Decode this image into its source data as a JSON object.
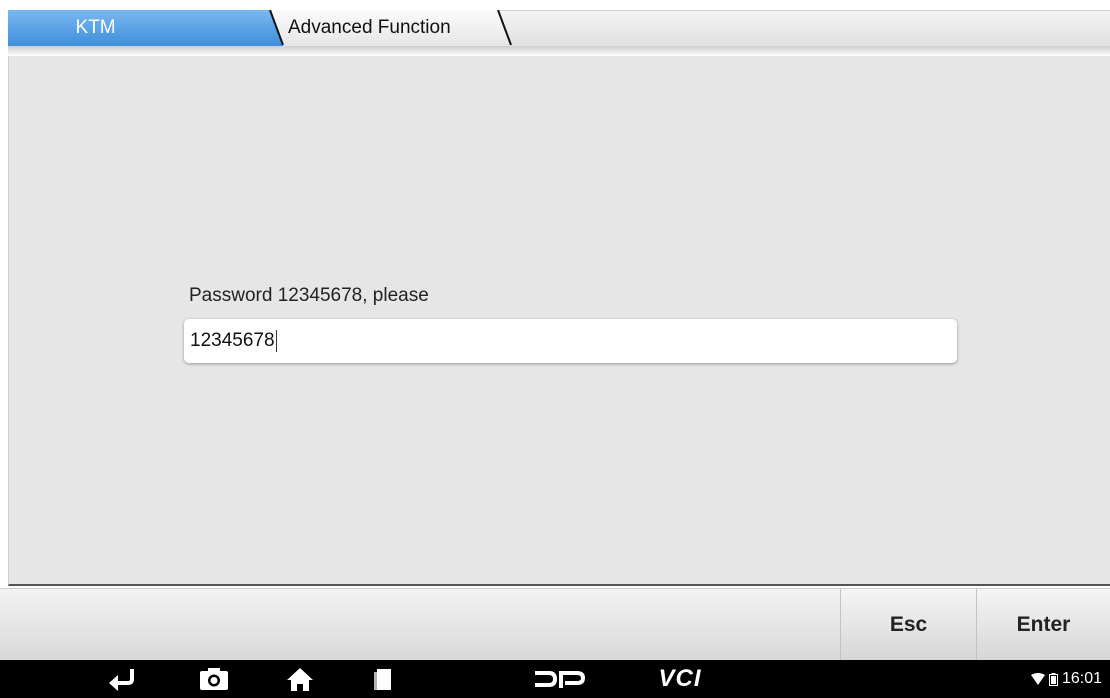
{
  "tabs": {
    "active_label": "KTM",
    "second_label": "Advanced Function"
  },
  "dialog": {
    "prompt": "Password 12345678, please",
    "input_value": "12345678"
  },
  "buttons": {
    "esc_label": "Esc",
    "enter_label": "Enter"
  },
  "navbar": {
    "icons": [
      "back-icon",
      "screenshot-icon",
      "home-icon",
      "recent-apps-icon",
      "dp-icon",
      "vci-icon"
    ],
    "vci_label": "VCI"
  },
  "status_bar": {
    "time": "16:01",
    "icons": [
      "wifi-icon",
      "battery-icon"
    ]
  },
  "colors": {
    "active_tab": "#4a96e0",
    "nav_bg": "#000000",
    "content_bg": "#e6e6e6"
  }
}
